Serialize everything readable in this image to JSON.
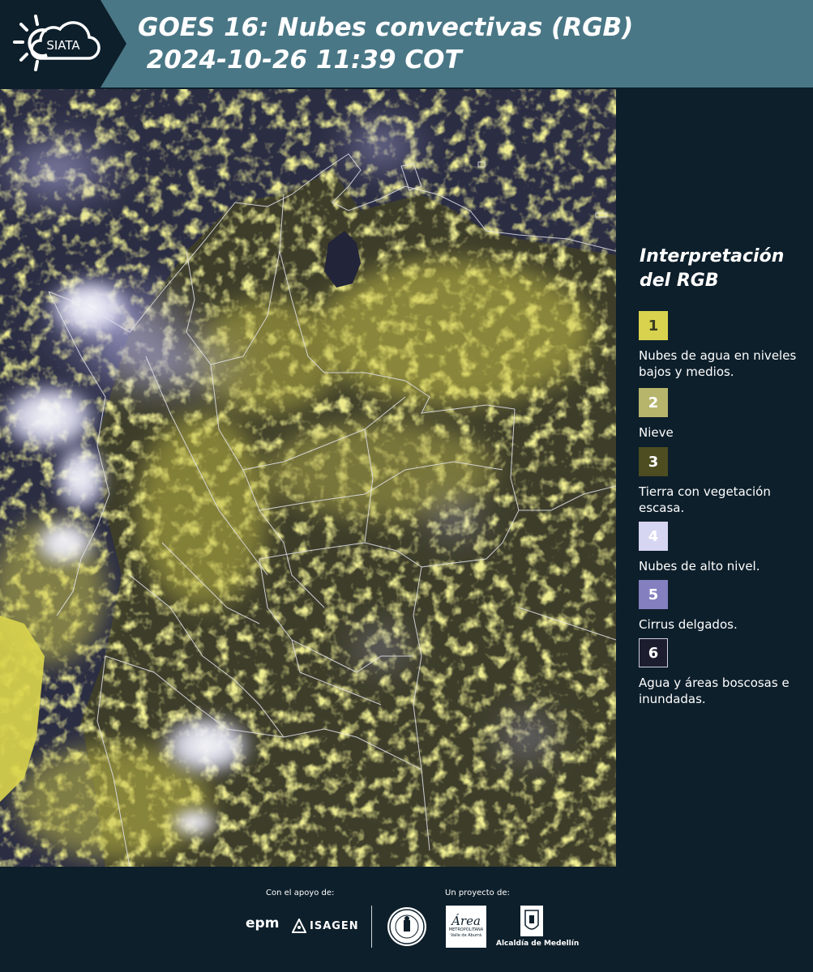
{
  "header": {
    "logo_text": "SIATA",
    "title_line1": "GOES 16: Nubes convectivas (RGB)",
    "title_line2": " 2024-10-26 11:39 COT"
  },
  "legend": {
    "title": "Interpretación del RGB",
    "items": [
      {
        "number": "1",
        "label": "Nubes de agua en niveles bajos y medios.",
        "color": "#d8d24e",
        "text_color": "#3a3a20"
      },
      {
        "number": "2",
        "label": "Nieve",
        "color": "#b7b56c",
        "text_color": "#ffffff"
      },
      {
        "number": "3",
        "label": "Tierra con vegetación escasa.",
        "color": "#4d4d21",
        "text_color": "#ffffff"
      },
      {
        "number": "4",
        "label": "Nubes de alto nivel.",
        "color": "#d6d5f2",
        "text_color": "#ffffff"
      },
      {
        "number": "5",
        "label": "Cirrus delgados.",
        "color": "#8480c0",
        "text_color": "#ffffff"
      },
      {
        "number": "6",
        "label": "Agua y áreas boscosas e inundadas.",
        "color": "#1d1d30",
        "text_color": "#ffffff"
      }
    ]
  },
  "footer": {
    "support_label": "Con el apoyo de:",
    "project_label": "Un proyecto de:",
    "epm": "epm",
    "isagen": "ISAGEN",
    "area_metro": "Área",
    "area_metro_sub1": "METROPOLITANA",
    "area_metro_sub2": "Valle de Aburrá",
    "alcaldia": "Alcaldía de Medellín"
  },
  "colors": {
    "header_bg": "#4a7786",
    "logo_bg": "#0d1f2b",
    "page_bg": "#0d1f2b"
  }
}
